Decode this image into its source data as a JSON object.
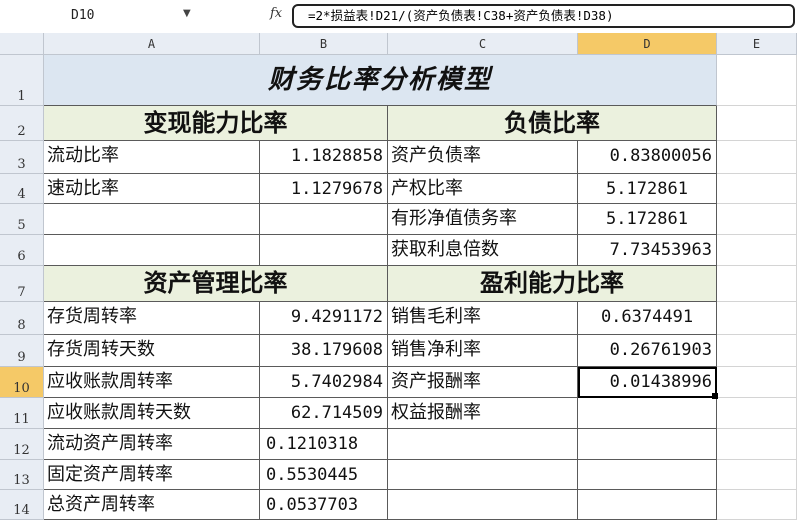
{
  "formula_bar": {
    "name_box": "D10",
    "fx_label": "fx",
    "formula": "=2*损益表!D21/(资产负债表!C38+资产负债表!D38)"
  },
  "columns": [
    "A",
    "B",
    "C",
    "D",
    "E"
  ],
  "rows": [
    "1",
    "2",
    "3",
    "4",
    "5",
    "6",
    "7",
    "8",
    "9",
    "10",
    "11",
    "12",
    "13",
    "14"
  ],
  "selected": {
    "column": "D",
    "row": "10"
  },
  "title": "财务比率分析模型",
  "sections": {
    "liquidity": "变现能力比率",
    "debt": "负债比率",
    "asset_mgmt": "资产管理比率",
    "profit": "盈利能力比率"
  },
  "cells": {
    "A3": "流动比率",
    "B3": "1.1828858",
    "C3": "资产负债率",
    "D3": "0.83800056",
    "A4": "速动比率",
    "B4": "1.1279678",
    "C4": "产权比率",
    "D4": "5.172861",
    "C5": "有形净值债务率",
    "D5": "5.172861",
    "C6": "获取利息倍数",
    "D6": "7.73453963",
    "A8": "存货周转率",
    "B8": "9.4291172",
    "C8": "销售毛利率",
    "D8": "0.6374491",
    "A9": "存货周转天数",
    "B9": "38.179608",
    "C9": "销售净利率",
    "D9": "0.26761903",
    "A10": "应收账款周转率",
    "B10": "5.7402984",
    "C10": "资产报酬率",
    "D10": "0.01438996",
    "A11": "应收账款周转天数",
    "B11": "62.714509",
    "C11": "权益报酬率",
    "A12": "流动资产周转率",
    "B12": "0.1210318",
    "A13": "固定资产周转率",
    "B13": "0.5530445",
    "A14": "总资产周转率",
    "B14": "0.0537703"
  }
}
